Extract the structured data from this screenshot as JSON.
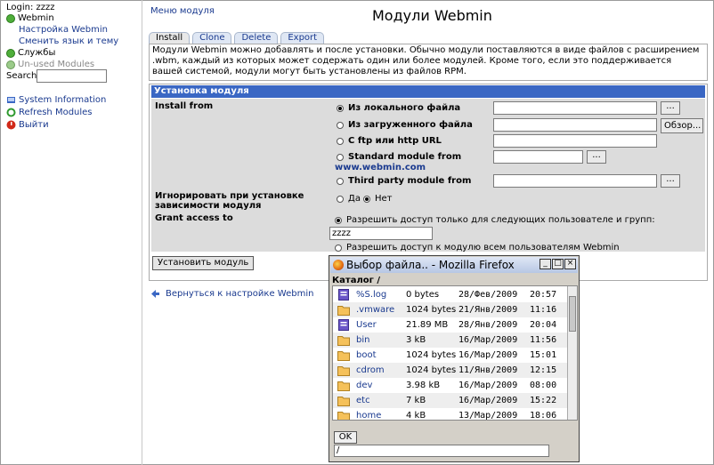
{
  "sidebar": {
    "login": "Login: zzzz",
    "webmin_label": "Webmin",
    "webmin_config": "Настройка Webmin",
    "change_lang": "Сменить язык и тему",
    "services": "Службы",
    "unused": "Un-used Modules",
    "search_label": "Search:",
    "search_value": "",
    "system_info": "System Information",
    "refresh_modules": "Refresh Modules",
    "logout": "Выйти"
  },
  "header": {
    "module_menu": "Меню модуля",
    "title": "Модули Webmin"
  },
  "tabs": [
    {
      "label": "Install"
    },
    {
      "label": "Clone"
    },
    {
      "label": "Delete"
    },
    {
      "label": "Export"
    }
  ],
  "description": "Модули Webmin можно добавлять и после установки. Обычно модули поставляются в виде файлов с расширением .wbm, каждый из которых может содержать один или более модулей. Кроме того, если это поддерживается вашей системой, модули могут быть установлены из файлов RPM.",
  "form": {
    "section_title": "Установка модуля",
    "install_from_label": "Install from",
    "opt_local": "Из локального файла",
    "opt_uploaded": "Из загруженного файла",
    "opt_ftp": "С ftp или http URL",
    "opt_standard": "Standard module from",
    "standard_url": "www.webmin.com",
    "opt_third": "Third party module from",
    "browse_label": "Обзор...",
    "small_btn_label": "...",
    "ignore_label": "Игнорировать при установке зависимости модуля",
    "yes": "Да",
    "no": "Нет",
    "grant_label": "Grant access to",
    "grant_opt1": "Разрешить доступ только для следующих пользователе и групп:",
    "grant_users": "zzzz",
    "grant_opt2": "Разрешить доступ к модулю всем пользователям Webmin",
    "submit": "Установить модуль"
  },
  "back_link": "Вернуться к настройке Webmin",
  "popup": {
    "title": "Выбор файла.. - Mozilla Firefox",
    "catalog": "Каталог /",
    "ok": "OK",
    "path": "/",
    "files": [
      {
        "name": "%S.log",
        "size": "0 bytes",
        "date": "28/Фев/2009",
        "time": "20:57",
        "icon": "document-icon"
      },
      {
        "name": ".vmware",
        "size": "1024 bytes",
        "date": "21/Янв/2009",
        "time": "11:16",
        "icon": "folder-icon"
      },
      {
        "name": "User",
        "size": "21.89 MB",
        "date": "28/Янв/2009",
        "time": "20:04",
        "icon": "document-icon"
      },
      {
        "name": "bin",
        "size": "3 kB",
        "date": "16/Мар/2009",
        "time": "11:56",
        "icon": "folder-icon"
      },
      {
        "name": "boot",
        "size": "1024 bytes",
        "date": "16/Мар/2009",
        "time": "15:01",
        "icon": "folder-icon"
      },
      {
        "name": "cdrom",
        "size": "1024 bytes",
        "date": "11/Янв/2009",
        "time": "12:15",
        "icon": "folder-icon"
      },
      {
        "name": "dev",
        "size": "3.98 kB",
        "date": "16/Мар/2009",
        "time": "08:00",
        "icon": "folder-icon"
      },
      {
        "name": "etc",
        "size": "7 kB",
        "date": "16/Мар/2009",
        "time": "15:22",
        "icon": "folder-icon"
      },
      {
        "name": "home",
        "size": "4 kB",
        "date": "13/Мар/2009",
        "time": "18:06",
        "icon": "folder-icon"
      }
    ]
  }
}
